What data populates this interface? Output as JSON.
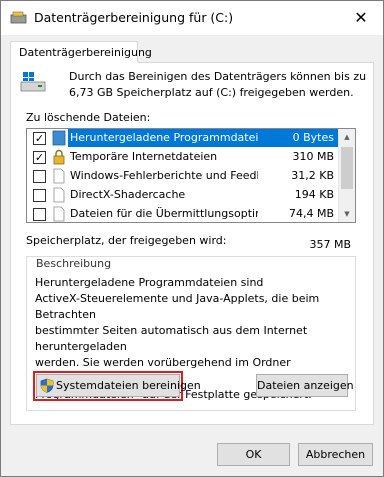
{
  "window": {
    "title": "Datenträgerbereinigung für  (C:)",
    "close_glyph": "✕"
  },
  "tab": {
    "label": "Datenträgerbereinigung"
  },
  "intro": {
    "line1": "Durch das Bereinigen des Datenträgers können bis zu",
    "line2": "6,73 GB Speicherplatz auf  (C:) freigegeben werden."
  },
  "files": {
    "label": "Zu löschende Dateien:",
    "rows": [
      {
        "name": "Heruntergeladene Programmdateien",
        "size": "0 Bytes",
        "checked": true,
        "selected": true,
        "check_glyph": "✓",
        "icon": "folder-icon"
      },
      {
        "name": "Temporäre Internetdateien",
        "size": "310 MB",
        "checked": true,
        "selected": false,
        "check_glyph": "✓",
        "icon": "lock-icon"
      },
      {
        "name": "Windows-Fehlerberichte und Feedbac...",
        "size": "31,2 KB",
        "checked": false,
        "selected": false,
        "check_glyph": "",
        "icon": "document-icon"
      },
      {
        "name": "DirectX-Shadercache",
        "size": "194 KB",
        "checked": false,
        "selected": false,
        "check_glyph": "",
        "icon": "document-icon"
      },
      {
        "name": "Dateien für die Übermittlungsoptimierung",
        "size": "74,4 MB",
        "checked": false,
        "selected": false,
        "check_glyph": "",
        "icon": "document-icon"
      }
    ],
    "scroll_up_glyph": "▲",
    "scroll_down_glyph": "▼"
  },
  "space": {
    "label": "Speicherplatz, der freigegeben wird:",
    "value": "357 MB"
  },
  "description": {
    "title": "Beschreibung",
    "text": "Heruntergeladene Programmdateien sind\nActiveX-Steuerelemente und Java-Applets, die beim Betrachten\nbestimmter Seiten automatisch aus dem Internet heruntergeladen\nwerden. Sie werden vorübergehend im Ordner \"Heruntergeladene\nProgrammdateien\" auf der Festplatte gespeichert."
  },
  "buttons": {
    "cleanup_system": "Systemdateien bereinigen",
    "view_files": "Dateien anzeigen",
    "ok": "OK",
    "cancel": "Abbrechen"
  },
  "colors": {
    "selection": "#0078d7",
    "highlight_outline": "#e01b1b",
    "drive_accent": "#0078d7"
  }
}
